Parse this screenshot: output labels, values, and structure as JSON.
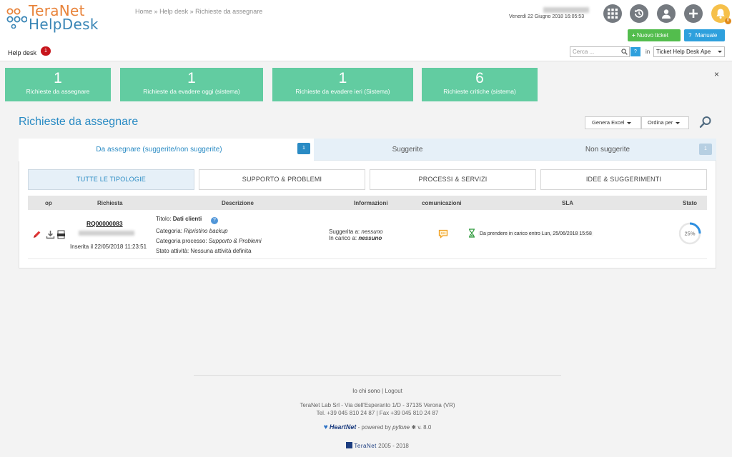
{
  "header": {
    "logo_line1": "TeraNet",
    "logo_line2": "HelpDesk",
    "breadcrumb": [
      "Home",
      "Help desk",
      "Richieste da assegnare"
    ],
    "breadcrumb_sep": "»",
    "date": "Venerdì 22 Giugno 2018 16:05:53",
    "icons": [
      "apps-grid-icon",
      "history-icon",
      "user-icon",
      "add-icon",
      "bell-icon"
    ],
    "notify_count": "0",
    "new_ticket": "Nuovo ticket",
    "manual": "Manuale",
    "section_label": "Help desk",
    "section_badge": "1",
    "search_placeholder": "Cerca ...",
    "help_mark": "?",
    "in_label": "in",
    "scope_value": "Ticket Help Desk Ape"
  },
  "cards": [
    {
      "value": "1",
      "label": "Richieste da assegnare"
    },
    {
      "value": "1",
      "label": "Richieste da evadere oggi (sistema)"
    },
    {
      "value": "1",
      "label": "Richieste da evadere ieri (Sistema)"
    },
    {
      "value": "6",
      "label": "Richieste critiche (sistema)"
    }
  ],
  "close_symbol": "×",
  "main": {
    "title": "Richieste da assegnare",
    "export_label": "Genera Excel",
    "sort_label": "Ordina per",
    "tabs": [
      {
        "label": "Da assegnare (suggerite/non suggerite)",
        "badge": "1"
      },
      {
        "label": "Suggerite",
        "badge": ""
      },
      {
        "label": "Non suggerite",
        "badge": "1"
      }
    ],
    "filters": [
      "TUTTE LE TIPOLOGIE",
      "SUPPORTO & PROBLEMI",
      "PROCESSI & SERVIZI",
      "IDEE & SUGGERIMENTI"
    ],
    "columns": [
      "op",
      "Richiesta",
      "Descrizione",
      "Informazioni",
      "comunicazioni",
      "SLA",
      "Stato"
    ],
    "row": {
      "code": "RQ00000083",
      "inserted": "Inserita il 22/05/2018 11:23:51",
      "title_label": "Titolo:",
      "title_value": "Dati clienti",
      "category_label": "Categoria:",
      "category_value": "Ripristino backup",
      "process_label": "Categoria processo:",
      "process_value": "Supporto & Problemi",
      "activity_label": "Stato attività:",
      "activity_value": "Nessuna attività definita",
      "suggested_label": "Suggerita a:",
      "suggested_value": "nessuno",
      "assigned_label": "In carico a:",
      "assigned_value": "nessuno",
      "sla_text": "Da prendere in carico entro Lun, 25/06/2018 15:58",
      "progress_percent": 25,
      "progress_label": "25%"
    }
  },
  "footer": {
    "about": "Io chi sono",
    "sep": "|",
    "logout": "Logout",
    "address": "TeraNet Lab Srl - Via dell'Esperanto 1/D - 37135 Verona (VR)",
    "phone": "Tel. +39 045 810 24 87 | Fax +39 045 810 24 87",
    "brand": "HeartNet",
    "powered": "- powered by",
    "engine": "pyfone",
    "version": "v. 8.0",
    "company": "TeraNet",
    "years": "2005 - 2018"
  },
  "colors": {
    "accent": "#2a8bc4",
    "card": "#62cca1",
    "green_button": "#53bd4d",
    "blue_button": "#2ea0dd",
    "badge_red": "#c7151c",
    "logo_orange": "#e8833a",
    "logo_blue": "#3a86b6"
  }
}
